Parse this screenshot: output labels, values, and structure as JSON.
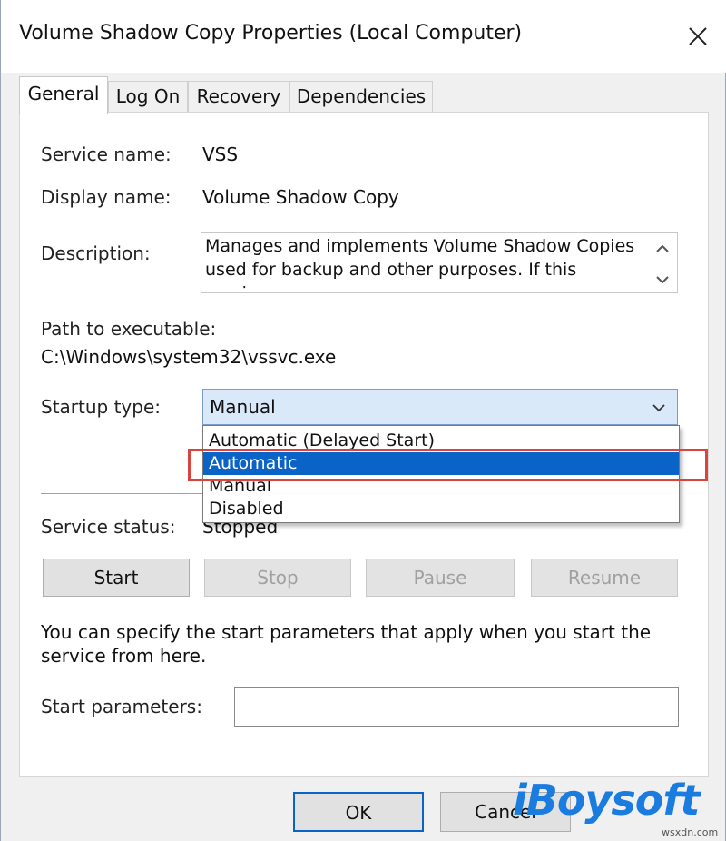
{
  "window": {
    "title": "Volume Shadow Copy Properties (Local Computer)"
  },
  "tabs": [
    {
      "label": "General",
      "active": true
    },
    {
      "label": "Log On",
      "active": false
    },
    {
      "label": "Recovery",
      "active": false
    },
    {
      "label": "Dependencies",
      "active": false
    }
  ],
  "general": {
    "service_name_label": "Service name:",
    "service_name": "VSS",
    "display_name_label": "Display name:",
    "display_name": "Volume Shadow Copy",
    "description_label": "Description:",
    "description": "Manages and implements Volume Shadow Copies used for backup and other purposes. If this service",
    "path_label": "Path to executable:",
    "path": "C:\\Windows\\system32\\vssvc.exe",
    "startup_type_label": "Startup type:",
    "startup_type_value": "Manual",
    "startup_options": [
      {
        "label": "Automatic (Delayed Start)",
        "selected": false
      },
      {
        "label": "Automatic",
        "selected": true
      },
      {
        "label": "Manual",
        "selected": false
      },
      {
        "label": "Disabled",
        "selected": false
      }
    ],
    "service_status_label": "Service status:",
    "service_status": "Stopped",
    "buttons": {
      "start": "Start",
      "stop": "Stop",
      "pause": "Pause",
      "resume": "Resume"
    },
    "info_text": "You can specify the start parameters that apply when you start the service from here.",
    "start_params_label": "Start parameters:",
    "start_params_value": ""
  },
  "footer": {
    "ok": "OK",
    "cancel": "Cancel"
  },
  "watermark": {
    "brand": "iBoysoft",
    "site": "wsxdn.com"
  },
  "colors": {
    "selection": "#0a64c8",
    "highlight_box": "#d9443c",
    "watermark": "#1b7ce0"
  },
  "icons": {
    "close": "close-icon",
    "chevron": "chevron-down-icon",
    "scroll_up": "chevron-up-icon"
  }
}
